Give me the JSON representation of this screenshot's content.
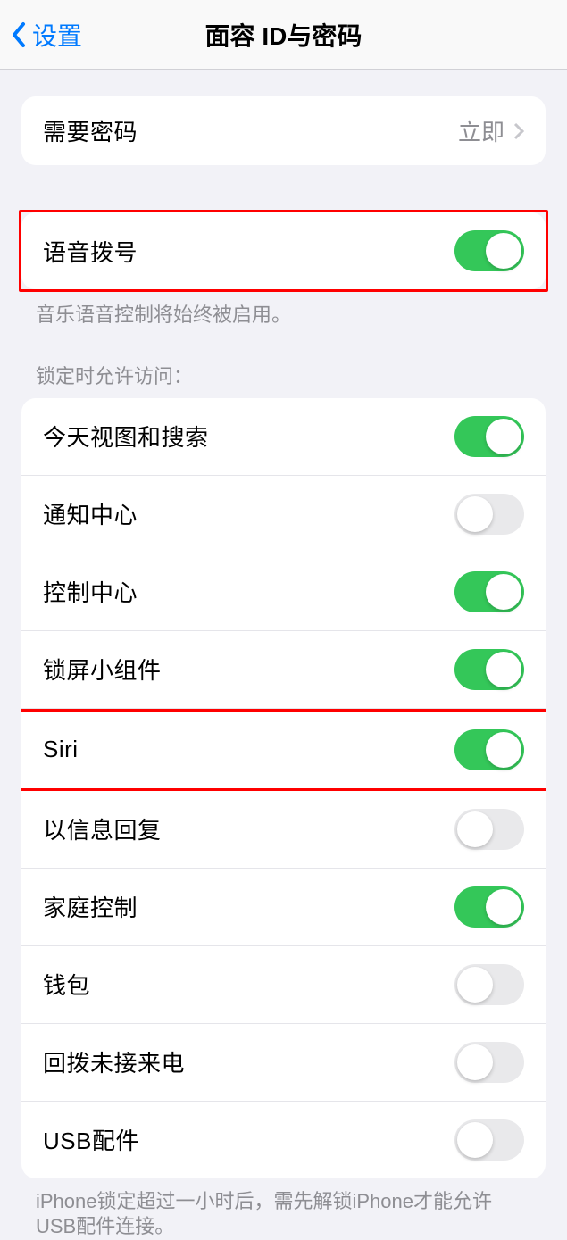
{
  "header": {
    "back_label": "设置",
    "title": "面容 ID与密码"
  },
  "passcode_section": {
    "require_passcode_label": "需要密码",
    "require_passcode_value": "立即"
  },
  "voice_dial_section": {
    "voice_dial_label": "语音拨号",
    "voice_dial_on": true,
    "footer": "音乐语音控制将始终被启用。"
  },
  "lock_access_section": {
    "header": "锁定时允许访问：",
    "items": [
      {
        "label": "今天视图和搜索",
        "on": true
      },
      {
        "label": "通知中心",
        "on": false
      },
      {
        "label": "控制中心",
        "on": true
      },
      {
        "label": "锁屏小组件",
        "on": true
      },
      {
        "label": "Siri",
        "on": true
      },
      {
        "label": "以信息回复",
        "on": false
      },
      {
        "label": "家庭控制",
        "on": true
      },
      {
        "label": "钱包",
        "on": false
      },
      {
        "label": "回拨未接来电",
        "on": false
      },
      {
        "label": "USB配件",
        "on": false
      }
    ],
    "footer": "iPhone锁定超过一小时后，需先解锁iPhone才能允许USB配件连接。"
  }
}
